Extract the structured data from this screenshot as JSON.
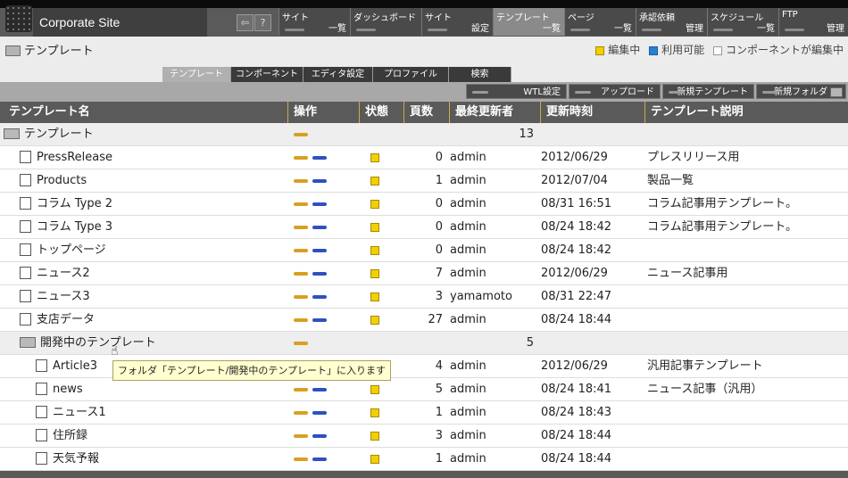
{
  "header": {
    "site_title": "Corporate Site",
    "icons": [
      "logout-icon",
      "help-icon"
    ],
    "help_label": "?",
    "menu": [
      {
        "top": "サイト",
        "bottom": "一覧"
      },
      {
        "top": "ダッシュボード",
        "bottom": ""
      },
      {
        "top": "サイト",
        "bottom": "設定"
      },
      {
        "top": "テンプレート",
        "bottom": "一覧"
      },
      {
        "top": "ページ",
        "bottom": "一覧"
      },
      {
        "top": "承認依頼",
        "bottom": "管理"
      },
      {
        "top": "スケジュール",
        "bottom": "一覧"
      },
      {
        "top": "FTP",
        "bottom": "管理"
      }
    ]
  },
  "breadcrumb": {
    "label": "テンプレート"
  },
  "legend": {
    "editing": "編集中",
    "available": "利用可能",
    "component_editing": "コンポーネントが編集中",
    "colors": {
      "editing": "#f2d000",
      "available": "#2a7fd0",
      "component_editing": "#ffffff"
    }
  },
  "tabs": [
    "テンプレート",
    "コンポーネント",
    "エディタ設定",
    "プロファイル",
    "検索"
  ],
  "toolbar": {
    "wtl": "WTL設定",
    "upload": "アップロード",
    "new_template": "新規テンプレート",
    "new_folder": "新規フォルダ"
  },
  "table": {
    "headers": {
      "name": "テンプレート名",
      "ops": "操作",
      "status": "状態",
      "pages": "頁数",
      "updater": "最終更新者",
      "time": "更新時刻",
      "desc": "テンプレート説明"
    },
    "rows": [
      {
        "type": "folder",
        "indent": 0,
        "name": "テンプレート",
        "pages": "13",
        "updater": "",
        "time": "",
        "desc": ""
      },
      {
        "type": "file",
        "indent": 1,
        "name": "PressRelease",
        "pages": "0",
        "updater": "admin",
        "time": "2012/06/29",
        "desc": "プレスリリース用"
      },
      {
        "type": "file",
        "indent": 1,
        "name": "Products",
        "pages": "1",
        "updater": "admin",
        "time": "2012/07/04",
        "desc": "製品一覧"
      },
      {
        "type": "file",
        "indent": 1,
        "name": "コラム Type 2",
        "pages": "0",
        "updater": "admin",
        "time": "08/31 16:51",
        "desc": "コラム記事用テンプレート。"
      },
      {
        "type": "file",
        "indent": 1,
        "name": "コラム Type 3",
        "pages": "0",
        "updater": "admin",
        "time": "08/24 18:42",
        "desc": "コラム記事用テンプレート。"
      },
      {
        "type": "file",
        "indent": 1,
        "name": "トップページ",
        "pages": "0",
        "updater": "admin",
        "time": "08/24 18:42",
        "desc": ""
      },
      {
        "type": "file",
        "indent": 1,
        "name": "ニュース2",
        "pages": "7",
        "updater": "admin",
        "time": "2012/06/29",
        "desc": "ニュース記事用"
      },
      {
        "type": "file",
        "indent": 1,
        "name": "ニュース3",
        "pages": "3",
        "updater": "yamamoto",
        "time": "08/31 22:47",
        "desc": ""
      },
      {
        "type": "file",
        "indent": 1,
        "name": "支店データ",
        "pages": "27",
        "updater": "admin",
        "time": "08/24 18:44",
        "desc": ""
      },
      {
        "type": "folder",
        "indent": 1,
        "name": "開発中のテンプレート",
        "pages": "5",
        "updater": "",
        "time": "",
        "desc": ""
      },
      {
        "type": "file",
        "indent": 2,
        "name": "Article3",
        "pages": "4",
        "updater": "admin",
        "time": "2012/06/29",
        "desc": "汎用記事テンプレート"
      },
      {
        "type": "file",
        "indent": 2,
        "name": "news",
        "pages": "5",
        "updater": "admin",
        "time": "08/24 18:41",
        "desc": "ニュース記事（汎用）"
      },
      {
        "type": "file",
        "indent": 2,
        "name": "ニュース1",
        "pages": "1",
        "updater": "admin",
        "time": "08/24 18:43",
        "desc": ""
      },
      {
        "type": "file",
        "indent": 2,
        "name": "住所録",
        "pages": "3",
        "updater": "admin",
        "time": "08/24 18:44",
        "desc": ""
      },
      {
        "type": "file",
        "indent": 2,
        "name": "天気予報",
        "pages": "1",
        "updater": "admin",
        "time": "08/24 18:44",
        "desc": ""
      }
    ]
  },
  "tooltip": {
    "text": "フォルダ「テンプレート/開発中のテンプレート」に入ります"
  }
}
